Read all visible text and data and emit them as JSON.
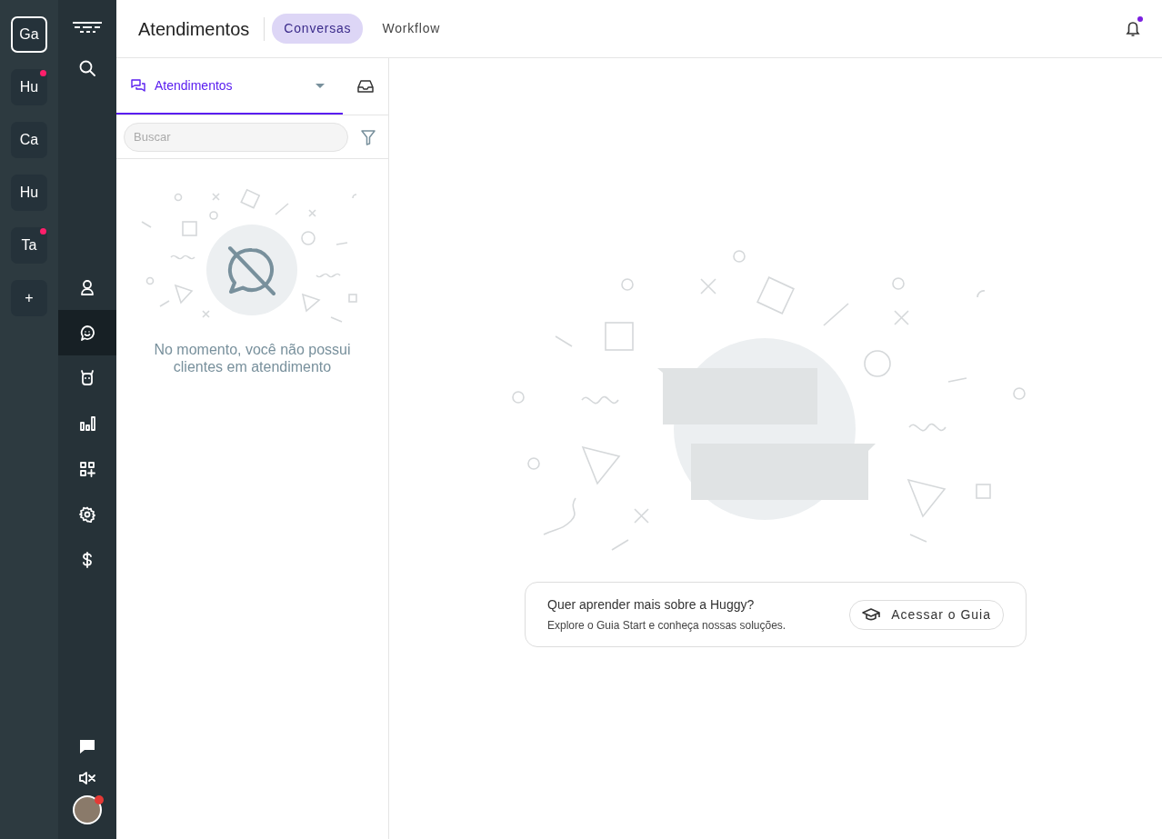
{
  "workspaces": [
    {
      "label": "Ga",
      "selected": true,
      "unread": false
    },
    {
      "label": "Hu",
      "selected": false,
      "unread": true
    },
    {
      "label": "Ca",
      "selected": false,
      "unread": false
    },
    {
      "label": "Hu",
      "selected": false,
      "unread": false
    },
    {
      "label": "Ta",
      "selected": false,
      "unread": true
    }
  ],
  "add_workspace": "+",
  "nav": {
    "items": [
      {
        "kind": "contacts",
        "selected": false
      },
      {
        "kind": "chats",
        "selected": true
      },
      {
        "kind": "bots",
        "selected": false
      },
      {
        "kind": "reports",
        "selected": false
      },
      {
        "kind": "apps",
        "selected": false
      },
      {
        "kind": "settings",
        "selected": false
      },
      {
        "kind": "billing",
        "selected": false
      }
    ]
  },
  "header": {
    "title": "Atendimentos",
    "tabs": [
      {
        "label": "Conversas",
        "selected": true
      },
      {
        "label": "Workflow",
        "selected": false
      }
    ],
    "notifications_unread": true
  },
  "panel": {
    "tab": "Atendimentos",
    "search": {
      "placeholder": "Buscar"
    },
    "empty_message": "No momento, você não possui clientes em atendimento"
  },
  "guide": {
    "title": "Quer aprender mais sobre a Huggy?",
    "subtitle": "Explore o Guia Start e conheça nossas soluções.",
    "button": "Acessar o Guia"
  }
}
